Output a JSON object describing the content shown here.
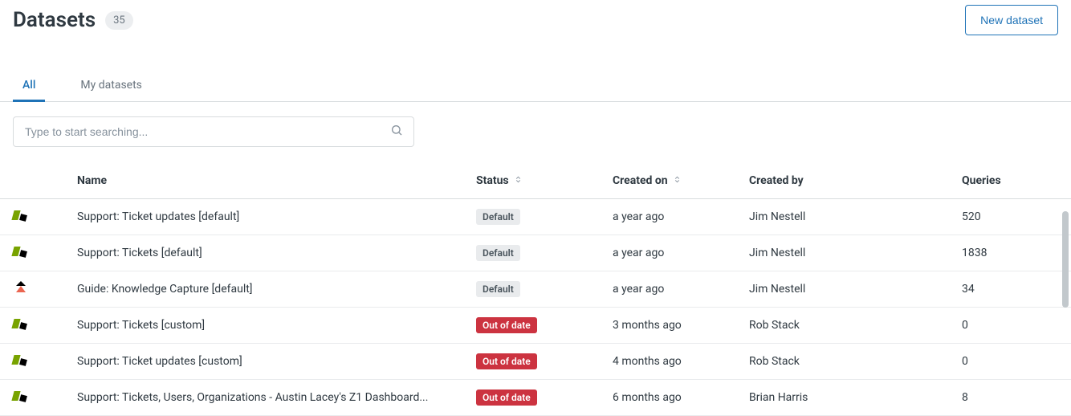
{
  "header": {
    "title": "Datasets",
    "count": "35",
    "new_button": "New dataset"
  },
  "tabs": [
    {
      "label": "All",
      "active": true
    },
    {
      "label": "My datasets",
      "active": false
    }
  ],
  "search": {
    "placeholder": "Type to start searching..."
  },
  "columns": {
    "name": "Name",
    "status": "Status",
    "created_on": "Created on",
    "created_by": "Created by",
    "queries": "Queries"
  },
  "status_labels": {
    "default": "Default",
    "out_of_date": "Out of date"
  },
  "rows": [
    {
      "icon": "support",
      "name": "Support: Ticket updates [default]",
      "status": "default",
      "created_on": "a year ago",
      "created_by": "Jim Nestell",
      "queries": "520"
    },
    {
      "icon": "support",
      "name": "Support: Tickets [default]",
      "status": "default",
      "created_on": "a year ago",
      "created_by": "Jim Nestell",
      "queries": "1838"
    },
    {
      "icon": "guide",
      "name": "Guide: Knowledge Capture [default]",
      "status": "default",
      "created_on": "a year ago",
      "created_by": "Jim Nestell",
      "queries": "34"
    },
    {
      "icon": "support",
      "name": "Support: Tickets [custom]",
      "status": "out_of_date",
      "created_on": "3 months ago",
      "created_by": "Rob Stack",
      "queries": "0"
    },
    {
      "icon": "support",
      "name": "Support: Ticket updates [custom]",
      "status": "out_of_date",
      "created_on": "4 months ago",
      "created_by": "Rob Stack",
      "queries": "0"
    },
    {
      "icon": "support",
      "name": "Support: Tickets, Users, Organizations - Austin Lacey's Z1 Dashboard...",
      "status": "out_of_date",
      "created_on": "6 months ago",
      "created_by": "Brian Harris",
      "queries": "8"
    }
  ]
}
